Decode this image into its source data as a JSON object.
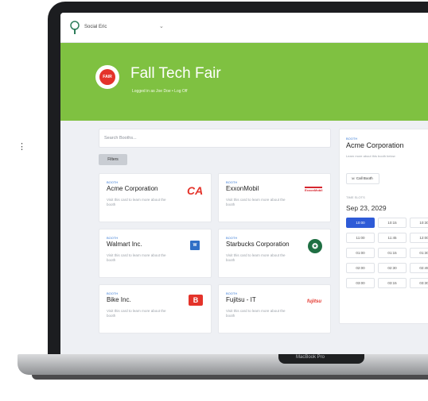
{
  "side_marker": "⋮",
  "app": {
    "org_name": "Social Eric",
    "org_chevron": "⌄"
  },
  "hero": {
    "badge_text": "FAIR",
    "title": "Fall Tech Fair",
    "subtitle": "Logged in as Joe Doe • Log Off"
  },
  "booths": {
    "search_placeholder": "Search Booths...",
    "filter_label": "Filters",
    "cards": [
      {
        "tag": "BOOTH",
        "name": "Acme Corporation",
        "desc": "Visit this card to learn more about the booth",
        "logo": "CA"
      },
      {
        "tag": "BOOTH",
        "name": "ExxonMobil",
        "desc": "Visit this card to learn more about the booth",
        "logo": "ExxonMobil"
      },
      {
        "tag": "BOOTH",
        "name": "Walmart Inc.",
        "desc": "Visit this card to learn more about the booth",
        "logo": "W"
      },
      {
        "tag": "BOOTH",
        "name": "Starbucks Corporation",
        "desc": "Visit this card to learn more about the booth",
        "logo": "✪"
      },
      {
        "tag": "BOOTH",
        "name": "Bike Inc.",
        "desc": "Visit this card to learn more about the booth",
        "logo": "B"
      },
      {
        "tag": "BOOTH",
        "name": "Fujitsu - IT",
        "desc": "Visit this card to learn more about the booth",
        "logo": "fujitsu"
      }
    ]
  },
  "detail": {
    "tag": "BOOTH",
    "name": "Acme Corporation",
    "desc": "Learn more about this booth below",
    "call_button": "☏ Call Booth",
    "slots_label": "TIME SLOTS",
    "date": "Sep 23, 2029",
    "slots": [
      "10:00",
      "10:15",
      "10:30",
      "11:00",
      "11:45",
      "12:00",
      "01:00",
      "01:15",
      "01:30",
      "02:00",
      "02:30",
      "02:45",
      "03:00",
      "03:15",
      "03:30"
    ]
  },
  "laptop": {
    "model_label": "MacBook Pro"
  },
  "colors": {
    "hero_green": "#7fc141",
    "accent_blue": "#2e5bd7",
    "brand_red": "#e4332a"
  }
}
